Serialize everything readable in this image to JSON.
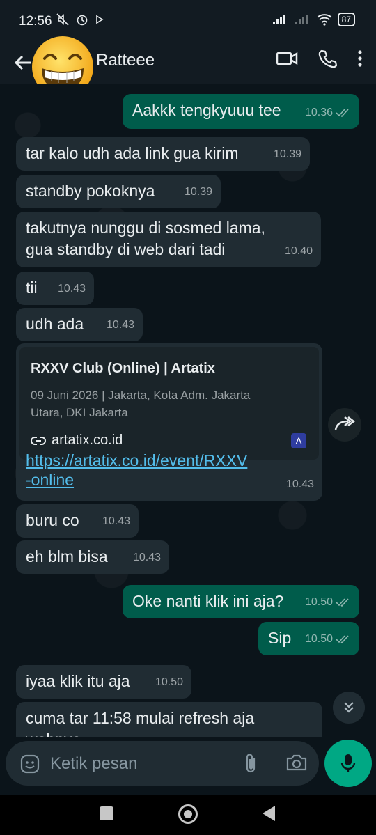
{
  "status": {
    "time": "12:56",
    "battery": "87",
    "left_icons": [
      "mute-icon",
      "alarm-icon",
      "play-icon"
    ],
    "right_icons": [
      "signal-icon",
      "signal-icon",
      "wifi-icon",
      "battery-icon"
    ]
  },
  "header": {
    "contact_name": "Ratteee",
    "avatar_icon": "grinning-emoji-avatar",
    "actions": [
      "video-call-icon",
      "phone-icon",
      "more-icon"
    ]
  },
  "messages": [
    {
      "dir": "out",
      "text": "Aakkk tengkyuuu tee",
      "time": "10.36",
      "read": true
    },
    {
      "dir": "in",
      "text": "tar kalo udh ada link gua kirim",
      "time": "10.39"
    },
    {
      "dir": "in",
      "text": "standby pokoknya",
      "time": "10.39"
    },
    {
      "dir": "in",
      "text": "takutnya nunggu di sosmed lama,",
      "text2": "gua standby di web dari tadi",
      "time": "10.40"
    },
    {
      "dir": "in",
      "text": "tii",
      "time": "10.43"
    },
    {
      "dir": "in",
      "text": "udh ada",
      "time": "10.43"
    },
    {
      "dir": "in",
      "link_preview": {
        "title": "RXXV Club (Online) | Artatix",
        "description_line1": "09 Juni 2026 | Jakarta, Kota Adm. Jakarta",
        "description_line2": "Utara, DKI Jakarta",
        "domain": "artatix.co.id",
        "logo": "Λ"
      },
      "url_line1": "https://artatix.co.id/event/RXXV",
      "url_line2": "-online",
      "time": "10.43"
    },
    {
      "dir": "in",
      "text": "buru co",
      "time": "10.43"
    },
    {
      "dir": "in",
      "text": "eh blm bisa",
      "time": "10.43"
    },
    {
      "dir": "out",
      "text": "Oke nanti klik ini aja?",
      "time": "10.50",
      "read": true
    },
    {
      "dir": "out",
      "text": "Sip",
      "time": "10.50",
      "read": true
    },
    {
      "dir": "in",
      "text": "iyaa klik itu aja",
      "time": "10.50"
    },
    {
      "dir": "in",
      "text": "cuma tar 11:58 mulai refresh aja",
      "text2": "webnya"
    }
  ],
  "input": {
    "placeholder": "Ketik pesan"
  },
  "colors": {
    "incoming": "#202c33",
    "outgoing": "#005c4b",
    "accent": "#00a884",
    "link": "#53bdeb"
  }
}
